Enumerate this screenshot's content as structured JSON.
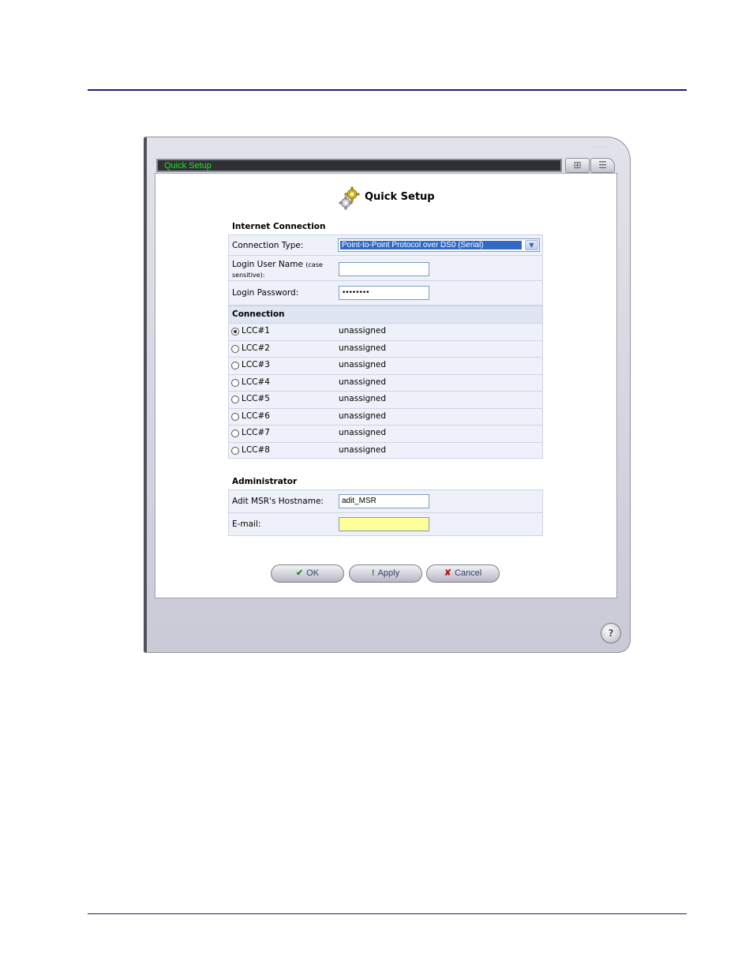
{
  "window": {
    "title": "Quick Setup",
    "grip": "·····",
    "toolbar_icons": [
      "sitemap-icon",
      "list-icon"
    ]
  },
  "page": {
    "title": "Quick Setup"
  },
  "internet": {
    "heading": "Internet Connection",
    "connection_type_label": "Connection Type:",
    "connection_type_value": "Point-to-Point Protocol over DS0 (Serial)",
    "login_user_label": "Login User Name",
    "login_user_note": "(case sensitive):",
    "login_user_value": "",
    "login_password_label": "Login Password:",
    "login_password_value": "••••••••"
  },
  "connection": {
    "heading": "Connection",
    "rows": [
      {
        "label": "LCC#1",
        "value": "unassigned",
        "selected": true
      },
      {
        "label": "LCC#2",
        "value": "unassigned",
        "selected": false
      },
      {
        "label": "LCC#3",
        "value": "unassigned",
        "selected": false
      },
      {
        "label": "LCC#4",
        "value": "unassigned",
        "selected": false
      },
      {
        "label": "LCC#5",
        "value": "unassigned",
        "selected": false
      },
      {
        "label": "LCC#6",
        "value": "unassigned",
        "selected": false
      },
      {
        "label": "LCC#7",
        "value": "unassigned",
        "selected": false
      },
      {
        "label": "LCC#8",
        "value": "unassigned",
        "selected": false
      }
    ]
  },
  "administrator": {
    "heading": "Administrator",
    "hostname_label": "Adit MSR's Hostname:",
    "hostname_value": "adit_MSR",
    "email_label": "E-mail:",
    "email_value": ""
  },
  "buttons": {
    "ok": "OK",
    "apply": "Apply",
    "cancel": "Cancel"
  },
  "help": {
    "icon": "help-icon",
    "glyph": "?"
  },
  "colors": {
    "title_text": "#18e818",
    "selection": "#316ac5",
    "email_field": "#ffff99",
    "rule": "#1c1e6e"
  }
}
